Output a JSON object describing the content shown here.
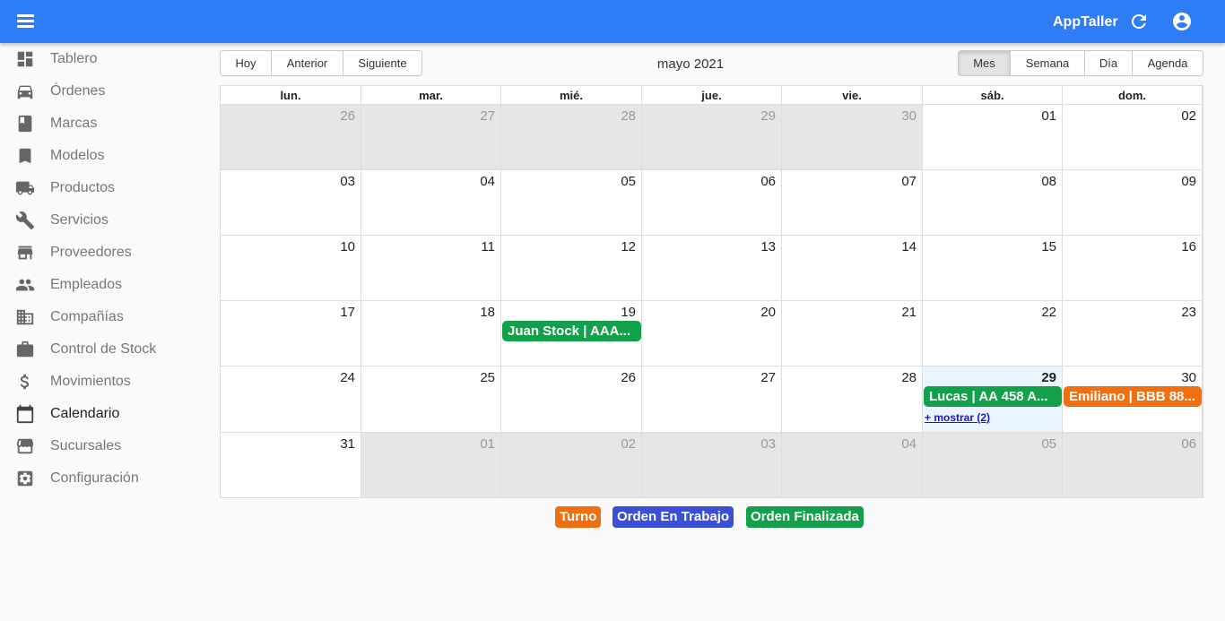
{
  "app": {
    "brand": "AppTaller",
    "colors": {
      "topbar": "#2e7cf6",
      "turno": "#f07011",
      "trabajo": "#3c4fd9",
      "finalizada": "#12a14a"
    }
  },
  "sidebar": {
    "items": [
      {
        "label": "Tablero",
        "icon": "dashboard-icon"
      },
      {
        "label": "Órdenes",
        "icon": "car-icon"
      },
      {
        "label": "Marcas",
        "icon": "book-icon"
      },
      {
        "label": "Modelos",
        "icon": "bookmark-icon"
      },
      {
        "label": "Productos",
        "icon": "truck-icon"
      },
      {
        "label": "Servicios",
        "icon": "wrench-icon"
      },
      {
        "label": "Proveedores",
        "icon": "store-icon"
      },
      {
        "label": "Empleados",
        "icon": "people-icon"
      },
      {
        "label": "Compañías",
        "icon": "building-icon"
      },
      {
        "label": "Control de Stock",
        "icon": "briefcase-icon"
      },
      {
        "label": "Movimientos",
        "icon": "dollar-icon"
      },
      {
        "label": "Calendario",
        "icon": "calendar-icon",
        "active": true
      },
      {
        "label": "Sucursales",
        "icon": "storefront-icon"
      },
      {
        "label": "Configuración",
        "icon": "settings-icon"
      }
    ]
  },
  "toolbar": {
    "today": "Hoy",
    "prev": "Anterior",
    "next": "Siguiente",
    "month": "mayo 2021",
    "views": {
      "month": "Mes",
      "week": "Semana",
      "day": "Día",
      "agenda": "Agenda"
    },
    "selected_view": "Mes"
  },
  "calendar": {
    "weekdays": [
      "lun.",
      "mar.",
      "mié.",
      "jue.",
      "vie.",
      "sáb.",
      "dom."
    ],
    "weeks": [
      [
        {
          "d": "26",
          "off": true
        },
        {
          "d": "27",
          "off": true
        },
        {
          "d": "28",
          "off": true
        },
        {
          "d": "29",
          "off": true
        },
        {
          "d": "30",
          "off": true
        },
        {
          "d": "01"
        },
        {
          "d": "02"
        }
      ],
      [
        {
          "d": "03"
        },
        {
          "d": "04"
        },
        {
          "d": "05"
        },
        {
          "d": "06"
        },
        {
          "d": "07"
        },
        {
          "d": "08"
        },
        {
          "d": "09"
        }
      ],
      [
        {
          "d": "10"
        },
        {
          "d": "11"
        },
        {
          "d": "12"
        },
        {
          "d": "13"
        },
        {
          "d": "14"
        },
        {
          "d": "15"
        },
        {
          "d": "16"
        }
      ],
      [
        {
          "d": "17"
        },
        {
          "d": "18"
        },
        {
          "d": "19"
        },
        {
          "d": "20"
        },
        {
          "d": "21"
        },
        {
          "d": "22"
        },
        {
          "d": "23"
        }
      ],
      [
        {
          "d": "24"
        },
        {
          "d": "25"
        },
        {
          "d": "26"
        },
        {
          "d": "27"
        },
        {
          "d": "28"
        },
        {
          "d": "29",
          "today": true
        },
        {
          "d": "30"
        }
      ],
      [
        {
          "d": "31"
        },
        {
          "d": "01",
          "off": true
        },
        {
          "d": "02",
          "off": true
        },
        {
          "d": "03",
          "off": true
        },
        {
          "d": "04",
          "off": true
        },
        {
          "d": "05",
          "off": true
        },
        {
          "d": "06",
          "off": true
        }
      ]
    ],
    "events": [
      {
        "title": "Juan Stock | AAA...",
        "week": 3,
        "day": 2,
        "type": "finalizada"
      },
      {
        "title": "Lucas | AA 458 A...",
        "week": 4,
        "day": 5,
        "type": "finalizada"
      },
      {
        "title": "Emiliano | BBB 88...",
        "week": 4,
        "day": 6,
        "type": "turno"
      }
    ],
    "show_more": {
      "label": "+ mostrar (2)",
      "week": 4,
      "day": 5
    }
  },
  "legend": {
    "turno": "Turno",
    "trabajo": "Orden En Trabajo",
    "finalizada": "Orden Finalizada"
  }
}
